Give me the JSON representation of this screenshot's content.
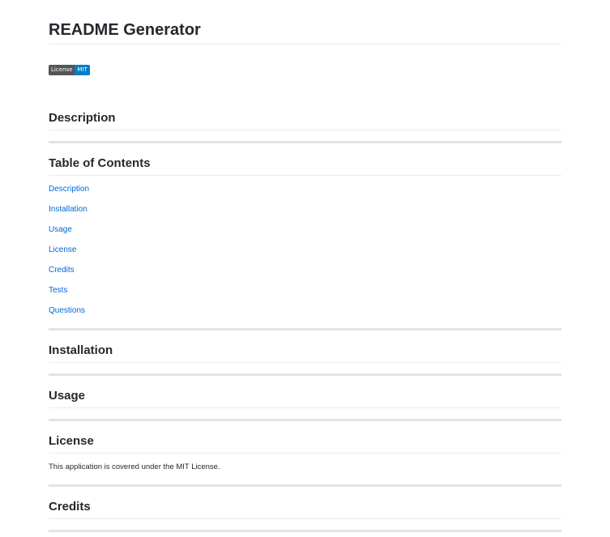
{
  "title": "README Generator",
  "badge": {
    "label": "License",
    "value": "MIT",
    "label_color": "#555555",
    "value_color": "#007ec6"
  },
  "sections": {
    "description": "Description",
    "toc": "Table of Contents",
    "installation": "Installation",
    "usage": "Usage",
    "license": "License",
    "credits": "Credits"
  },
  "toc_items": [
    "Description",
    "Installation",
    "Usage",
    "License",
    "Credits",
    "Tests",
    "Questions"
  ],
  "license_text": "This application is covered under the MIT License.",
  "link_color": "#0366d6"
}
